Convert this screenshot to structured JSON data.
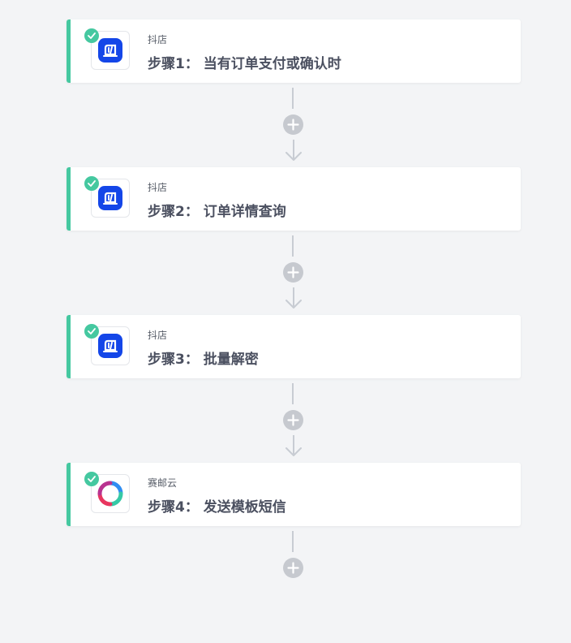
{
  "steps": [
    {
      "app_name": "抖店",
      "title": "步骤1： 当有订单支付或确认时",
      "app_icon": "doudian-logo",
      "status": "completed"
    },
    {
      "app_name": "抖店",
      "title": "步骤2： 订单详情查询",
      "app_icon": "doudian-logo",
      "status": "completed"
    },
    {
      "app_name": "抖店",
      "title": "步骤3： 批量解密",
      "app_icon": "doudian-logo",
      "status": "completed"
    },
    {
      "app_name": "赛邮云",
      "title": "步骤4： 发送模板短信",
      "app_icon": "saiyou-logo",
      "status": "completed"
    }
  ],
  "colors": {
    "accent": "#45c8a0",
    "doudian_blue": "#1446e8",
    "add_button": "#c6c9cf",
    "connector": "#c8ccd3",
    "background": "#f3f4f6"
  },
  "icons": {
    "check": "check-icon",
    "add": "plus-icon",
    "arrow": "arrow-down-icon"
  }
}
